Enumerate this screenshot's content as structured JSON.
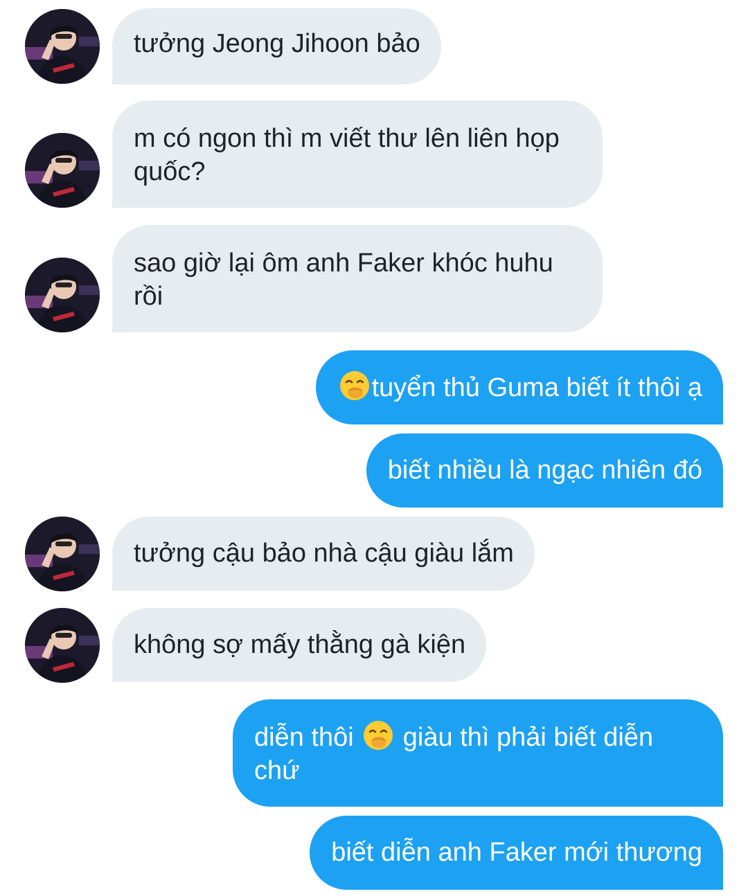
{
  "conversation": {
    "messages": [
      {
        "from": "other",
        "text": "tưởng Jeong Jihoon bảo"
      },
      {
        "from": "other",
        "text": "m có ngon thì m viết thư lên liên họp quốc?"
      },
      {
        "from": "other",
        "text": "sao giờ lại ôm anh Faker khóc huhu rồi"
      },
      {
        "from": "me",
        "emoji": "face-with-hand-over-mouth",
        "text": "tuyển thủ Guma biết ít thôi ạ"
      },
      {
        "from": "me",
        "text": "biết nhiều là ngạc nhiên đó"
      },
      {
        "from": "other",
        "text": "tưởng cậu bảo nhà cậu giàu lắm"
      },
      {
        "from": "other",
        "text": "không sợ mấy thằng gà kiện"
      },
      {
        "from": "me",
        "text_a": "diễn thôi",
        "emoji": "face-with-hand-over-mouth",
        "text_b": "giàu thì phải biết diễn chứ"
      },
      {
        "from": "me",
        "text": "biết diễn anh Faker mới thương"
      }
    ]
  },
  "colors": {
    "incoming_bubble": "#e6ecf0",
    "outgoing_bubble": "#1da1f2",
    "incoming_text": "#1f2329",
    "outgoing_text": "#ffffff"
  }
}
